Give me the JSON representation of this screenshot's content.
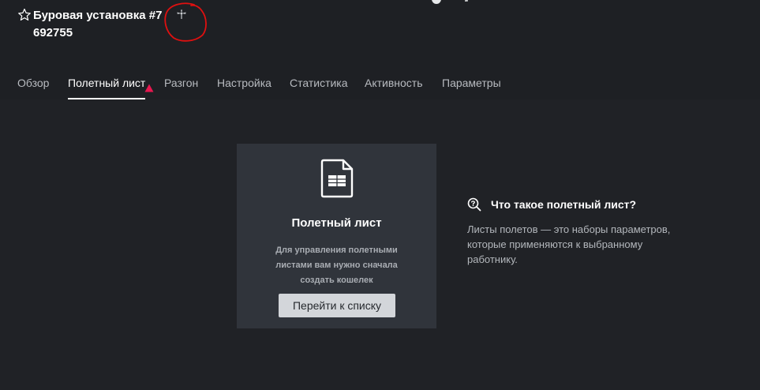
{
  "header": {
    "title": "Буровая установка #7",
    "worker_id": "692755",
    "icons": {
      "favorite": "star-outline-icon",
      "status": "fan-icon"
    }
  },
  "tabs": [
    {
      "label": "Обзор",
      "active": false
    },
    {
      "label": "Полетный лист",
      "active": true,
      "warning": true
    },
    {
      "label": "Разгон",
      "active": false
    },
    {
      "label": "Настройка",
      "active": false
    },
    {
      "label": "Статистика",
      "active": false
    },
    {
      "label": "Активность",
      "active": false
    },
    {
      "label": "Параметры",
      "active": false
    }
  ],
  "card": {
    "icon": "document-table-icon",
    "title": "Полетный лист",
    "description": "Для управления полетными листами вам нужно сначала создать кошелек",
    "button_label": "Перейти к списку"
  },
  "help": {
    "icon": "search-question-icon",
    "title": "Что такое полетный лист?",
    "text": "Листы полетов — это наборы параметров, которые применяются к выбранному работнику."
  },
  "colors": {
    "background": "#202226",
    "card": "#30343b",
    "warning": "#e8174f",
    "annotation": "#e01010"
  }
}
